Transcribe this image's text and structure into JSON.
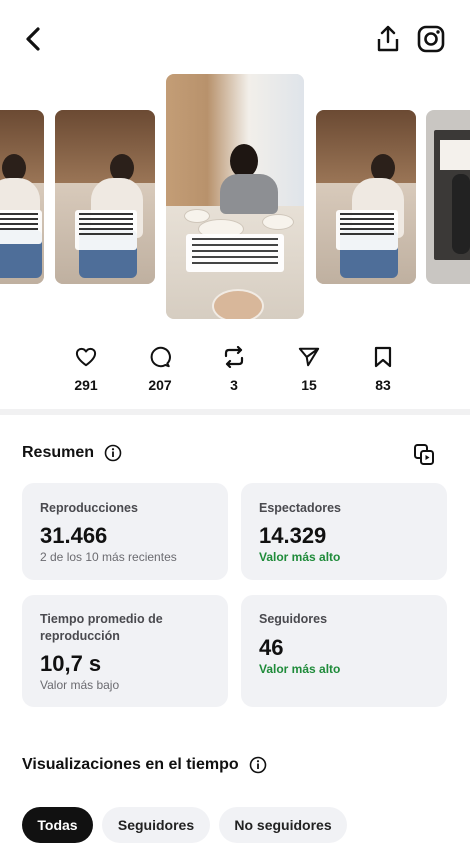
{
  "stats": [
    {
      "icon": "heart-icon",
      "value": "291"
    },
    {
      "icon": "comment-icon",
      "value": "207"
    },
    {
      "icon": "repost-icon",
      "value": "3"
    },
    {
      "icon": "send-icon",
      "value": "15"
    },
    {
      "icon": "bookmark-icon",
      "value": "83"
    }
  ],
  "summary": {
    "title": "Resumen",
    "cards": [
      {
        "label": "Reproducciones",
        "value": "31.466",
        "sub": "2 de los 10 más recientes"
      },
      {
        "label": "Espectadores",
        "value": "14.329",
        "sub": "Valor más alto"
      },
      {
        "label_line1": "Tiempo promedio de",
        "label_line2": "reproducción",
        "value": "10,7 s",
        "sub": "Valor más bajo"
      },
      {
        "label": "Seguidores",
        "value": "46",
        "sub": "Valor más alto"
      }
    ]
  },
  "views_over_time": {
    "title": "Visualizaciones en el tiempo",
    "filters": [
      "Todas",
      "Seguidores",
      "No seguidores"
    ],
    "active_filter": "Todas"
  },
  "colors": {
    "accent_green": "#1f8b3a",
    "card_bg": "#f1f2f5",
    "chip_active": "#111111"
  }
}
